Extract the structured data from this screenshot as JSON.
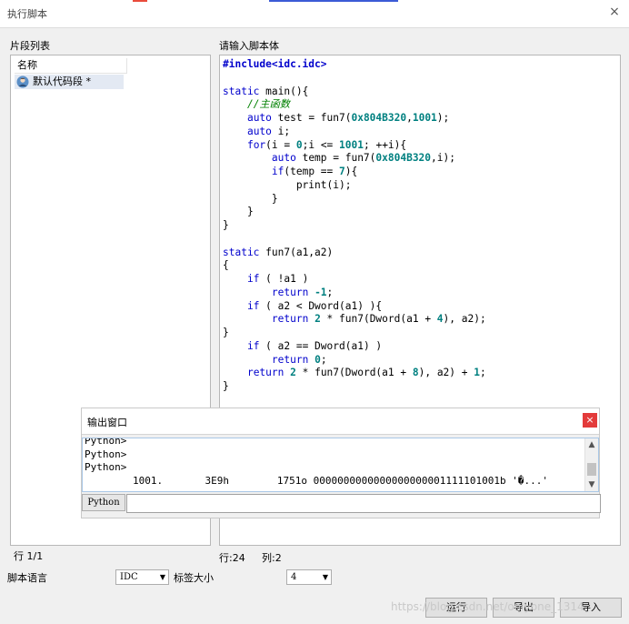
{
  "window": {
    "title": "执行脚本",
    "close_glyph": "×",
    "top_strip_colors": [
      "#e94b3c",
      "#3c5bd6"
    ]
  },
  "snippets": {
    "label": "片段列表",
    "column_header": "名称",
    "items": [
      {
        "label": "默认代码段 *",
        "icon": "user-avatar-icon"
      }
    ]
  },
  "editor": {
    "label": "请输入脚本体",
    "code_lines": [
      "#include<idc.idc>",
      "",
      "static main(){",
      "    //主函数",
      "    auto test = fun7(0x804B320,1001);",
      "    auto i;",
      "    for(i = 0;i <= 1001; ++i){",
      "        auto temp = fun7(0x804B320,i);",
      "        if(temp == 7){",
      "            print(i);",
      "        }",
      "    }",
      "}",
      "",
      "static fun7(a1,a2)",
      "{",
      "    if ( !a1 )",
      "        return -1;",
      "    if ( a2 < Dword(a1) ){",
      "        return 2 * fun7(Dword(a1 + 4), a2);",
      "}",
      "    if ( a2 == Dword(a1) )",
      "        return 0;",
      "    return 2 * fun7(Dword(a1 + 8), a2) + 1;",
      "}"
    ]
  },
  "status": {
    "left": "行 1/1",
    "line": "行:24",
    "col": "列:2"
  },
  "output": {
    "title": "输出窗口",
    "close_glyph": "×",
    "lines": [
      "Python>",
      "Python>",
      "Python>",
      "        1001.       3E9h        1751o 0000000000000000000001111101001b '�...'"
    ],
    "lang_button": "Python",
    "command_value": ""
  },
  "footer": {
    "script_lang_label": "脚本语言",
    "script_lang_value": "IDC",
    "tab_size_label": "标签大小",
    "tab_size_value": "4",
    "run": "运行",
    "export": "导出",
    "import": "导入"
  },
  "watermark": "https://blog.csdn.net/onlyone_1314"
}
